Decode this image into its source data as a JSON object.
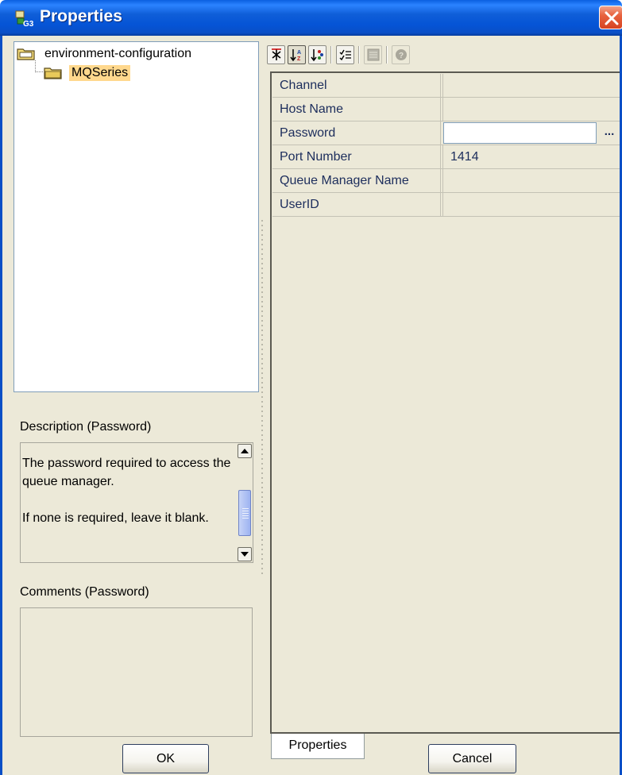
{
  "window": {
    "title": "Properties",
    "icon": "properties-app-icon",
    "close_icon": "close-icon"
  },
  "tree": {
    "items": [
      {
        "label": "environment-configuration",
        "icon": "folder-open-icon",
        "selected": false
      },
      {
        "label": "MQSeries",
        "icon": "folder-icon",
        "selected": true
      }
    ]
  },
  "description": {
    "label": "Description (Password)",
    "paragraphs": [
      "The password required to access the queue manager.",
      "If none is required, leave it blank."
    ]
  },
  "comments": {
    "label": "Comments (Password)",
    "value": ""
  },
  "toolbar": {
    "buttons": [
      {
        "name": "categorized-view-icon",
        "state": "normal"
      },
      {
        "name": "sort-alphabetical-icon",
        "state": "pressed"
      },
      {
        "name": "sort-by-category-icon",
        "state": "normal"
      },
      {
        "name": "show-descriptions-icon",
        "state": "normal"
      },
      {
        "name": "property-pages-icon",
        "state": "disabled"
      },
      {
        "name": "help-icon",
        "state": "disabled"
      }
    ]
  },
  "properties": {
    "rows": [
      {
        "name": "Channel",
        "value": ""
      },
      {
        "name": "Host Name",
        "value": ""
      },
      {
        "name": "Password",
        "value": "",
        "editor": "text-with-ellipsis"
      },
      {
        "name": "Port Number",
        "value": "1414"
      },
      {
        "name": "Queue Manager Name",
        "value": ""
      },
      {
        "name": "UserID",
        "value": ""
      }
    ],
    "ellipsis_label": "..."
  },
  "tabs": [
    {
      "label": "Properties",
      "active": true
    }
  ],
  "buttons": {
    "ok_label": "OK",
    "cancel_label": "Cancel"
  },
  "colors": {
    "titlebar": "#0a4fc6",
    "selection": "#ffd88d",
    "panel": "#ece9d8"
  }
}
